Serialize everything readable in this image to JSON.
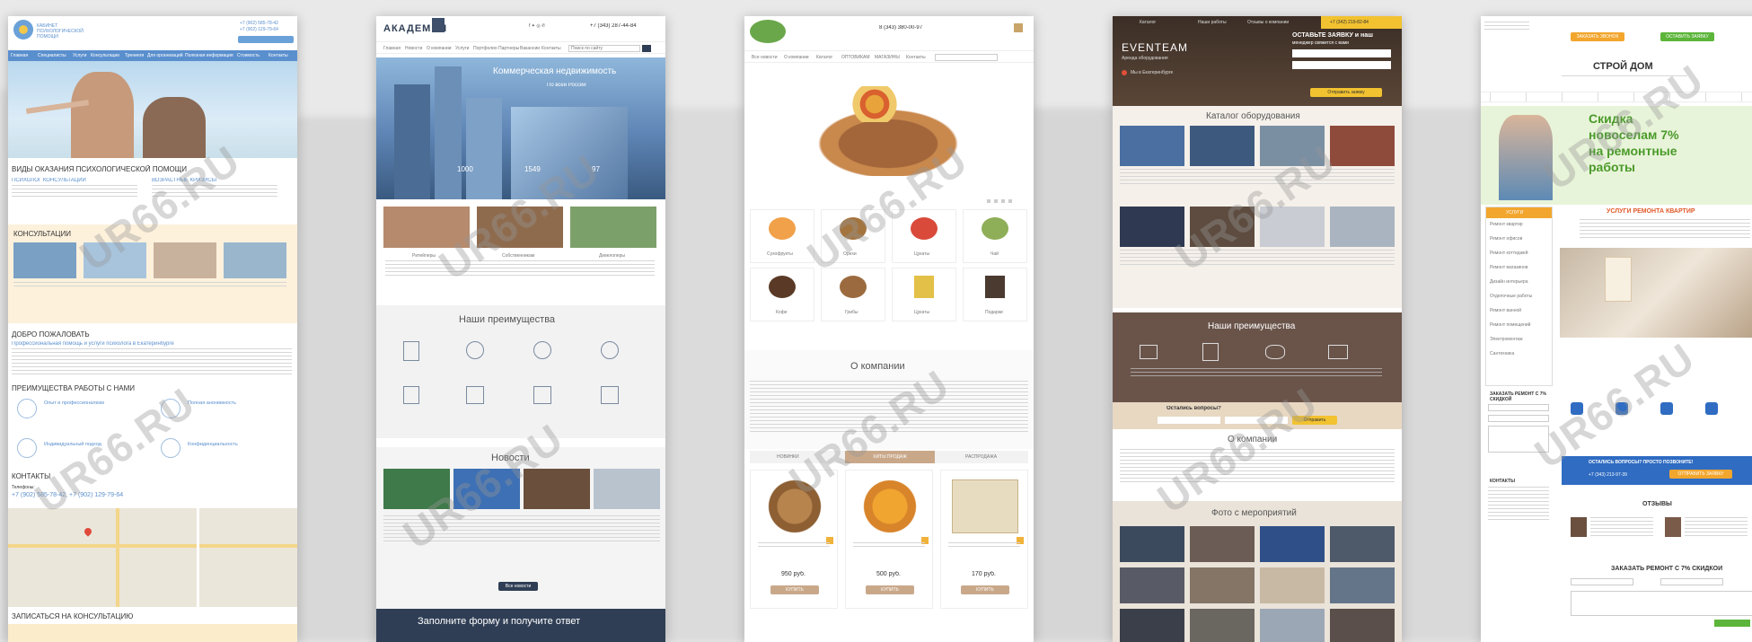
{
  "watermark": "UR66.RU",
  "shot1": {
    "company": "КАБИНЕТ ПСИХОЛОГИЧЕСКОЙ ПОМОЩИ",
    "phone1": "+7 (902) 585-78-42",
    "phone2": "+7 (902) 129-79-64",
    "nav": [
      "Главная",
      "Специалисты",
      "Услуги",
      "Консультации",
      "Тренинги",
      "Для организаций",
      "Полезная информация",
      "Стоимость",
      "Контакты"
    ],
    "section_services": "ВИДЫ ОКАЗАНИЯ ПСИХОЛОГИЧЕСКОЙ ПОМОЩИ",
    "service1": "ПСИХОЛОГ КОНСУЛЬТАЦИИ",
    "service2": "ВОЗРАСТНЫЕ КРИЗИСЫ",
    "section_consult": "КОНСУЛЬТАЦИИ",
    "section_welcome": "ДОБРО ПОЖАЛОВАТЬ",
    "welcome_sub": "Профессиональная помощь и услуги психолога в Екатеринбурге",
    "section_principles": "ПРЕИМУЩЕСТВА РАБОТЫ С НАМИ",
    "principles": [
      "Опыт и профессионализм",
      "Полная анонимность",
      "Индивидуальный подход",
      "Конфиденциальность"
    ],
    "section_contacts": "КОНТАКТЫ",
    "contact_label": "Телефоны:",
    "contact_phones": "+7 (902) 585-78-42, +7 (902) 129-79-64",
    "section_form": "ЗАПИСАТЬСЯ НА КОНСУЛЬТАЦИЮ"
  },
  "shot2": {
    "logo": "АКАДЕМИЯ",
    "phone": "+7 (343) 287-44-84",
    "nav": [
      "Главная",
      "Новости",
      "О компании",
      "Услуги",
      "Портфолио",
      "Партнеры",
      "Вакансии",
      "Контакты"
    ],
    "search_placeholder": "Поиск по сайту",
    "hero_title": "Коммерческая недвижимость",
    "hero_sub": "По всей России",
    "stats": [
      "1000",
      "1549",
      "97"
    ],
    "cards": [
      "Ритейлеры",
      "Собственникам",
      "Девелоперы"
    ],
    "section_adv": "Наши преимущества",
    "section_news": "Новости",
    "news_button": "Все новости",
    "section_form": "Заполните форму и получите ответ"
  },
  "shot3": {
    "nav": [
      "Все новости",
      "О компании",
      "Каталог",
      "ОПТОВИКАМ",
      "МАГАЗИНЫ",
      "Контакты"
    ],
    "phone": "8 (343) 380-00-97",
    "tiles": [
      "Сухофрукты",
      "Орехи",
      "Цукаты",
      "Чай",
      "Кофе",
      "Грибы",
      "Цукаты",
      "Подарки"
    ],
    "section_about": "О компании",
    "tabs": [
      "НОВИНКИ",
      "ХИТЫ ПРОДАЖ",
      "РАСПРОДАЖА"
    ],
    "prices": [
      "950 руб.",
      "500 руб.",
      "170 руб."
    ],
    "buy": "КУПИТЬ"
  },
  "shot4": {
    "nav": [
      "Каталог",
      "Наши работы",
      "Отзывы о компании"
    ],
    "phone": "+7 (342) 219-82-84",
    "logo": "EVENTEAM",
    "logo_sub": "Аренда оборудования",
    "city": "Мы в Екатеринбурге",
    "form_title": "ОСТАВЬТЕ ЗАЯВКУ и наш",
    "form_sub": "менеджер свяжется с вами",
    "submit": "Отправить заявку",
    "section_catalog": "Каталог оборудования",
    "section_adv": "Наши преимущества",
    "question": "Остались вопросы?",
    "question_button": "Отправить",
    "section_about": "О компании",
    "section_photos": "Фото с мероприятий"
  },
  "shot5": {
    "btn1": "ЗАКАЗАТЬ ЗВОНОК",
    "btn2": "ОСТАВИТЬ ЗАЯВКУ",
    "title": "СТРОЙ ДОМ",
    "banner1": "Скидка",
    "banner2": "новоселам 7%",
    "banner3": "на ремонтные",
    "banner4": "работы",
    "side_title": "УСЛУГИ",
    "side_items": [
      "Ремонт квартир",
      "Ремонт офисов",
      "Ремонт коттеджей",
      "Ремонт магазинов",
      "Дизайн интерьера",
      "Отделочные работы",
      "Ремонт ванной",
      "Ремонт помещений",
      "Электромонтаж",
      "Сантехника"
    ],
    "services_title": "УСЛУГИ РЕМОНТА КВАРТИР",
    "side_call": "ЗАКАЗАТЬ РЕМОНТ С 7% СКИДКОЙ",
    "question": "ОСТАЛИСЬ ВОПРОСЫ? ПРОСТО ПОЗВОНИТЕ!",
    "question_phone": "+7 (343) 213-97-39",
    "question_btn": "ОТПРАВИТЬ ЗАЯВКУ",
    "reviews": "ОТЗЫВЫ",
    "order": "ЗАКАЗАТЬ РЕМОНТ С 7% СКИДКОЙ",
    "contacts": "КОНТАКТЫ"
  }
}
